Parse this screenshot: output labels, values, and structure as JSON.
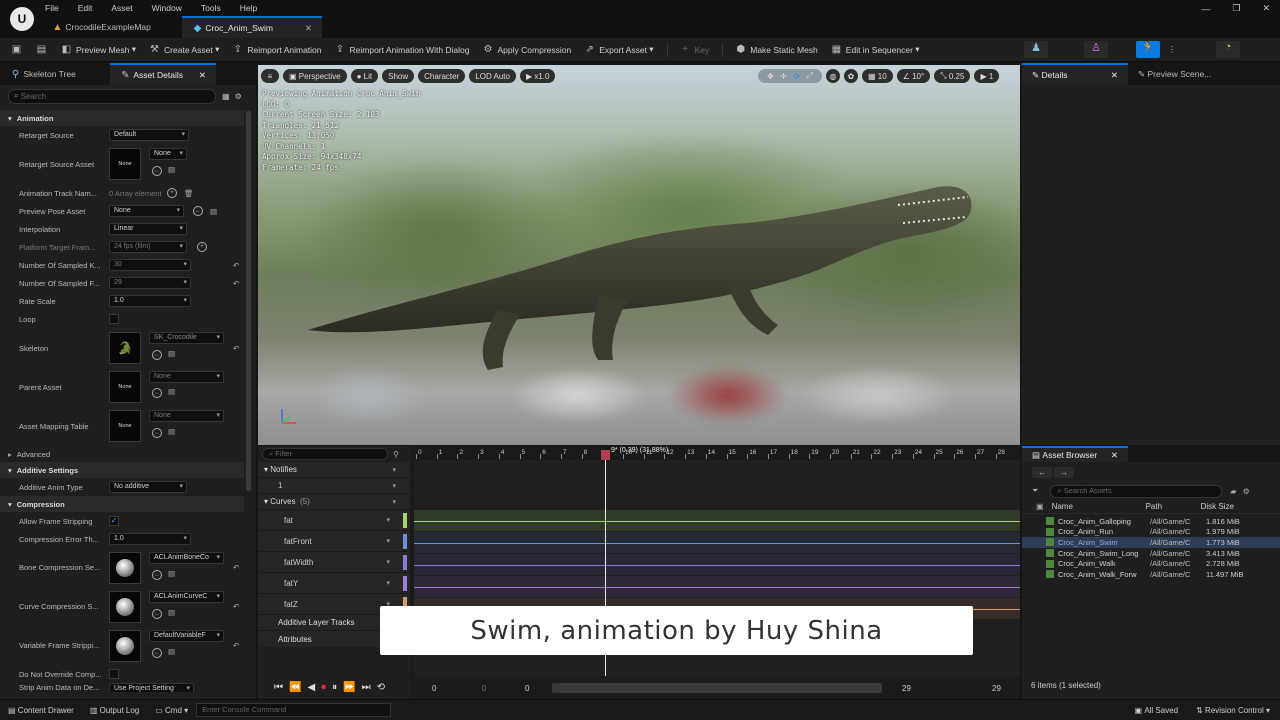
{
  "menu": [
    "File",
    "Edit",
    "Asset",
    "Window",
    "Tools",
    "Help"
  ],
  "tabs": [
    {
      "label": "CrocodileExampleMap"
    },
    {
      "label": "Croc_Anim_Swim"
    }
  ],
  "toolbar": {
    "preview_mesh": "Preview Mesh",
    "create_asset": "Create Asset",
    "reimport": "Reimport Animation",
    "reimport_dialog": "Reimport Animation With Dialog",
    "apply_compression": "Apply Compression",
    "export_asset": "Export Asset",
    "key": "Key",
    "make_static_mesh": "Make Static Mesh",
    "edit_sequencer": "Edit in Sequencer"
  },
  "left_panel": {
    "tab_skeleton": "Skeleton Tree",
    "tab_details": "Asset Details",
    "search_placeholder": "Search",
    "cat_animation": "Animation",
    "retarget_source": "Retarget Source",
    "retarget_source_val": "Default",
    "retarget_source_asset": "Retarget Source Asset",
    "none": "None",
    "anim_track": "Animation Track Nam...",
    "array_elem": "0 Array element",
    "preview_pose": "Preview Pose Asset",
    "interpolation": "Interpolation",
    "interp_val": "Linear",
    "platform_target": "Platform Target Fram...",
    "fps": "24 fps (film)",
    "sampled_keys": "Number Of Sampled K...",
    "sampled_keys_val": "30",
    "sampled_frames": "Number Of Sampled F...",
    "sampled_frames_val": "29",
    "rate_scale": "Rate Scale",
    "rate_scale_val": "1.0",
    "loop": "Loop",
    "skeleton": "Skeleton",
    "skeleton_val": "SK_Crocodile",
    "parent_asset": "Parent Asset",
    "mapping_table": "Asset Mapping Table",
    "advanced": "Advanced",
    "cat_additive": "Additive Settings",
    "additive_type": "Additive Anim Type",
    "additive_val": "No additive",
    "cat_compression": "Compression",
    "allow_strip": "Allow Frame Stripping",
    "comp_error": "Compression Error Th...",
    "comp_error_val": "1.0",
    "bone_comp": "Bone Compression Se...",
    "bone_comp_val": "ACLAnimBoneCo",
    "curve_comp": "Curve Compression S...",
    "curve_comp_val": "ACLAnimCurveC",
    "var_frame": "Variable Frame Strippi...",
    "var_frame_val": "DefaultVariableF",
    "no_override": "Do Not Override Comp...",
    "strip_rate": "Strip Anim Data on De...",
    "strip_rate_val": "Use Project Setting"
  },
  "viewport": {
    "perspective": "Perspective",
    "lit": "Lit",
    "show": "Show",
    "character": "Character",
    "lod": "LOD Auto",
    "speed": "x1.0",
    "grid": "10",
    "angle": "10°",
    "scale": "0.25",
    "cam": "1",
    "info": [
      "Previewing Animation Croc_Anim_Swim",
      "LOD: 0",
      "Current Screen Size: 2.103",
      "Triangles: 21,512",
      "Vertices: 13,050",
      "UV Channels: 1",
      "Approx Size: 94x348x74",
      "Framerate: 24 fps"
    ]
  },
  "timeline": {
    "filter": "Filter",
    "notifies": "Notifies",
    "notify_track": "1",
    "curves": "Curves",
    "curves_count": "(5)",
    "curve_names": [
      "fat",
      "fatFront",
      "fatWidth",
      "fatY",
      "fatZ"
    ],
    "curve_colors": [
      "#a6d66a",
      "#6b8fd8",
      "#8a7bd8",
      "#a67bd8",
      "#d89a6b"
    ],
    "additive_tracks": "Additive Layer Tracks",
    "attributes": "Attributes",
    "playhead": "9* (0.39) (31.88%)",
    "ticks": [
      "0",
      "1",
      "2",
      "3",
      "4",
      "5",
      "6",
      "7",
      "8",
      "10",
      "11",
      "12",
      "13",
      "14",
      "15",
      "16",
      "17",
      "18",
      "19",
      "20",
      "21",
      "22",
      "23",
      "24",
      "25",
      "26",
      "27",
      "28"
    ],
    "start": "0",
    "start2": "0",
    "start3": "0",
    "end": "29",
    "end2": "29"
  },
  "caption": "Swim, animation by Huy Shina",
  "right_panel": {
    "details": "Details",
    "preview_scene": "Preview Scene..."
  },
  "asset_browser": {
    "title": "Asset Browser",
    "search_placeholder": "Search Assets",
    "col_name": "Name",
    "col_path": "Path",
    "col_size": "Disk Size",
    "rows": [
      {
        "name": "Croc_Anim_Galloping",
        "path": "/All/Game/C",
        "size": "1.816 MiB"
      },
      {
        "name": "Croc_Anim_Run",
        "path": "/All/Game/C",
        "size": "1.979 MiB"
      },
      {
        "name": "Croc_Anim_Swim",
        "path": "/All/Game/C",
        "size": "1.773 MiB"
      },
      {
        "name": "Croc_Anim_Swim_Long",
        "path": "/All/Game/C",
        "size": "3.413 MiB"
      },
      {
        "name": "Croc_Anim_Walk",
        "path": "/All/Game/C",
        "size": "2.728 MiB"
      },
      {
        "name": "Croc_Anim_Walk_Forw",
        "path": "/All/Game/C",
        "size": "11.497 MiB"
      }
    ],
    "count": "6 items (1 selected)"
  },
  "statusbar": {
    "content_drawer": "Content Drawer",
    "output_log": "Output Log",
    "cmd": "Cmd",
    "console_placeholder": "Enter Console Command",
    "all_saved": "All Saved",
    "revision": "Revision Control"
  }
}
